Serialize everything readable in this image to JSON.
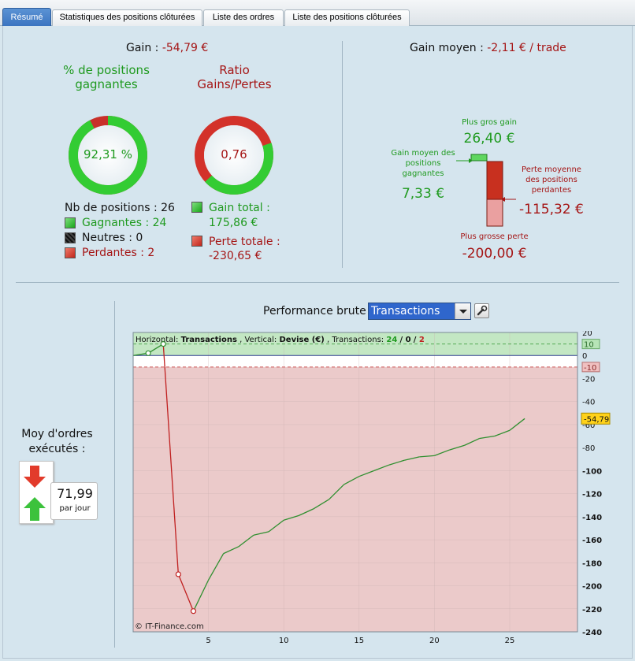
{
  "tabs": [
    {
      "label": "Résumé",
      "active": true
    },
    {
      "label": "Statistiques des positions clôturées",
      "active": false
    },
    {
      "label": "Liste des ordres",
      "active": false
    },
    {
      "label": "Liste des positions clôturées",
      "active": false
    }
  ],
  "summary": {
    "gain_label": "Gain :",
    "gain_value": "-54,79 €",
    "pct_title": "% de positions gagnantes",
    "pct_value": "92,31 %",
    "pct_fraction": 0.9231,
    "ratio_title": "Ratio Gains/Pertes",
    "ratio_value": "0,76",
    "ratio_fraction": 0.4324,
    "nb_positions": "Nb de positions : 26",
    "gagnantes": "Gagnantes : 24",
    "neutres": "Neutres : 0",
    "perdantes": "Perdantes : 2",
    "gain_total_label": "Gain total :",
    "gain_total_value": "175,86 €",
    "perte_totale_label": "Perte totale :",
    "perte_totale_value": "-230,65 €"
  },
  "average": {
    "label": "Gain moyen :",
    "value": "-2,11 € / trade",
    "plus_gros_gain_label": "Plus gros gain",
    "plus_gros_gain_value": "26,40 €",
    "gain_moyen_label": "Gain moyen des positions gagnantes",
    "gain_moyen_value": "7,33 €",
    "perte_moyenne_label": "Perte moyenne des positions perdantes",
    "perte_moyenne_value": "-115,32 €",
    "plus_grosse_perte_label": "Plus grosse perte",
    "plus_grosse_perte_value": "-200,00 €"
  },
  "orders": {
    "title": "Moy d'ordres exécutés :",
    "value": "71,99",
    "unit": "par jour"
  },
  "performance": {
    "title": "Performance brute",
    "select_value": "Transactions",
    "info_horizontal_label": "Horizontal:",
    "info_horizontal_value": "Transactions",
    "info_vertical_label": ", Vertical:",
    "info_vertical_value": "Devise (€)",
    "info_transactions_label": ", Transactions:",
    "info_win": "24",
    "info_sep1": " / ",
    "info_neutral": "0",
    "info_sep2": " / ",
    "info_loss": "2",
    "watermark": "© IT-Finance.com",
    "last_value_badge": "-54,79",
    "band_upper": "10",
    "band_lower": "-10"
  },
  "chart_data": {
    "type": "line",
    "xlabel": "",
    "ylabel": "",
    "xlim": [
      0,
      29.5
    ],
    "ylim": [
      -240,
      20
    ],
    "x_ticks": [
      5,
      10,
      15,
      20,
      25
    ],
    "y_ticks": [
      20,
      0,
      -20,
      -40,
      -60,
      -80,
      -100,
      -120,
      -140,
      -160,
      -180,
      -200,
      -220,
      -240
    ],
    "y_tick_labels": [
      "20",
      "0",
      "-20",
      "-40",
      "-60",
      "-80",
      "-100",
      "-120",
      "-140",
      "-160",
      "-180",
      "-200",
      "-220",
      "-240"
    ],
    "zones": {
      "gain_above": 0,
      "loss_below": -10,
      "upper_band": 10,
      "lower_band": -10
    },
    "colors": {
      "gain": "#2f8f2f",
      "loss": "#c02020",
      "zero_line": "#2d3b8f"
    },
    "series": [
      {
        "x": [
          0,
          1,
          2,
          3,
          4,
          5,
          6,
          7,
          8,
          9,
          10,
          11,
          12,
          13,
          14,
          15,
          16,
          17,
          18,
          19,
          20,
          21,
          22,
          23,
          24,
          25,
          26
        ],
        "y": [
          0,
          2,
          10,
          -190,
          -222,
          -195,
          -172,
          -166,
          -156,
          -153,
          -143,
          -139,
          -133,
          -125,
          -112,
          -105,
          -100,
          -95,
          -91,
          -88,
          -87,
          -82,
          -78,
          -72,
          -70,
          -65,
          -54.79
        ]
      }
    ]
  }
}
